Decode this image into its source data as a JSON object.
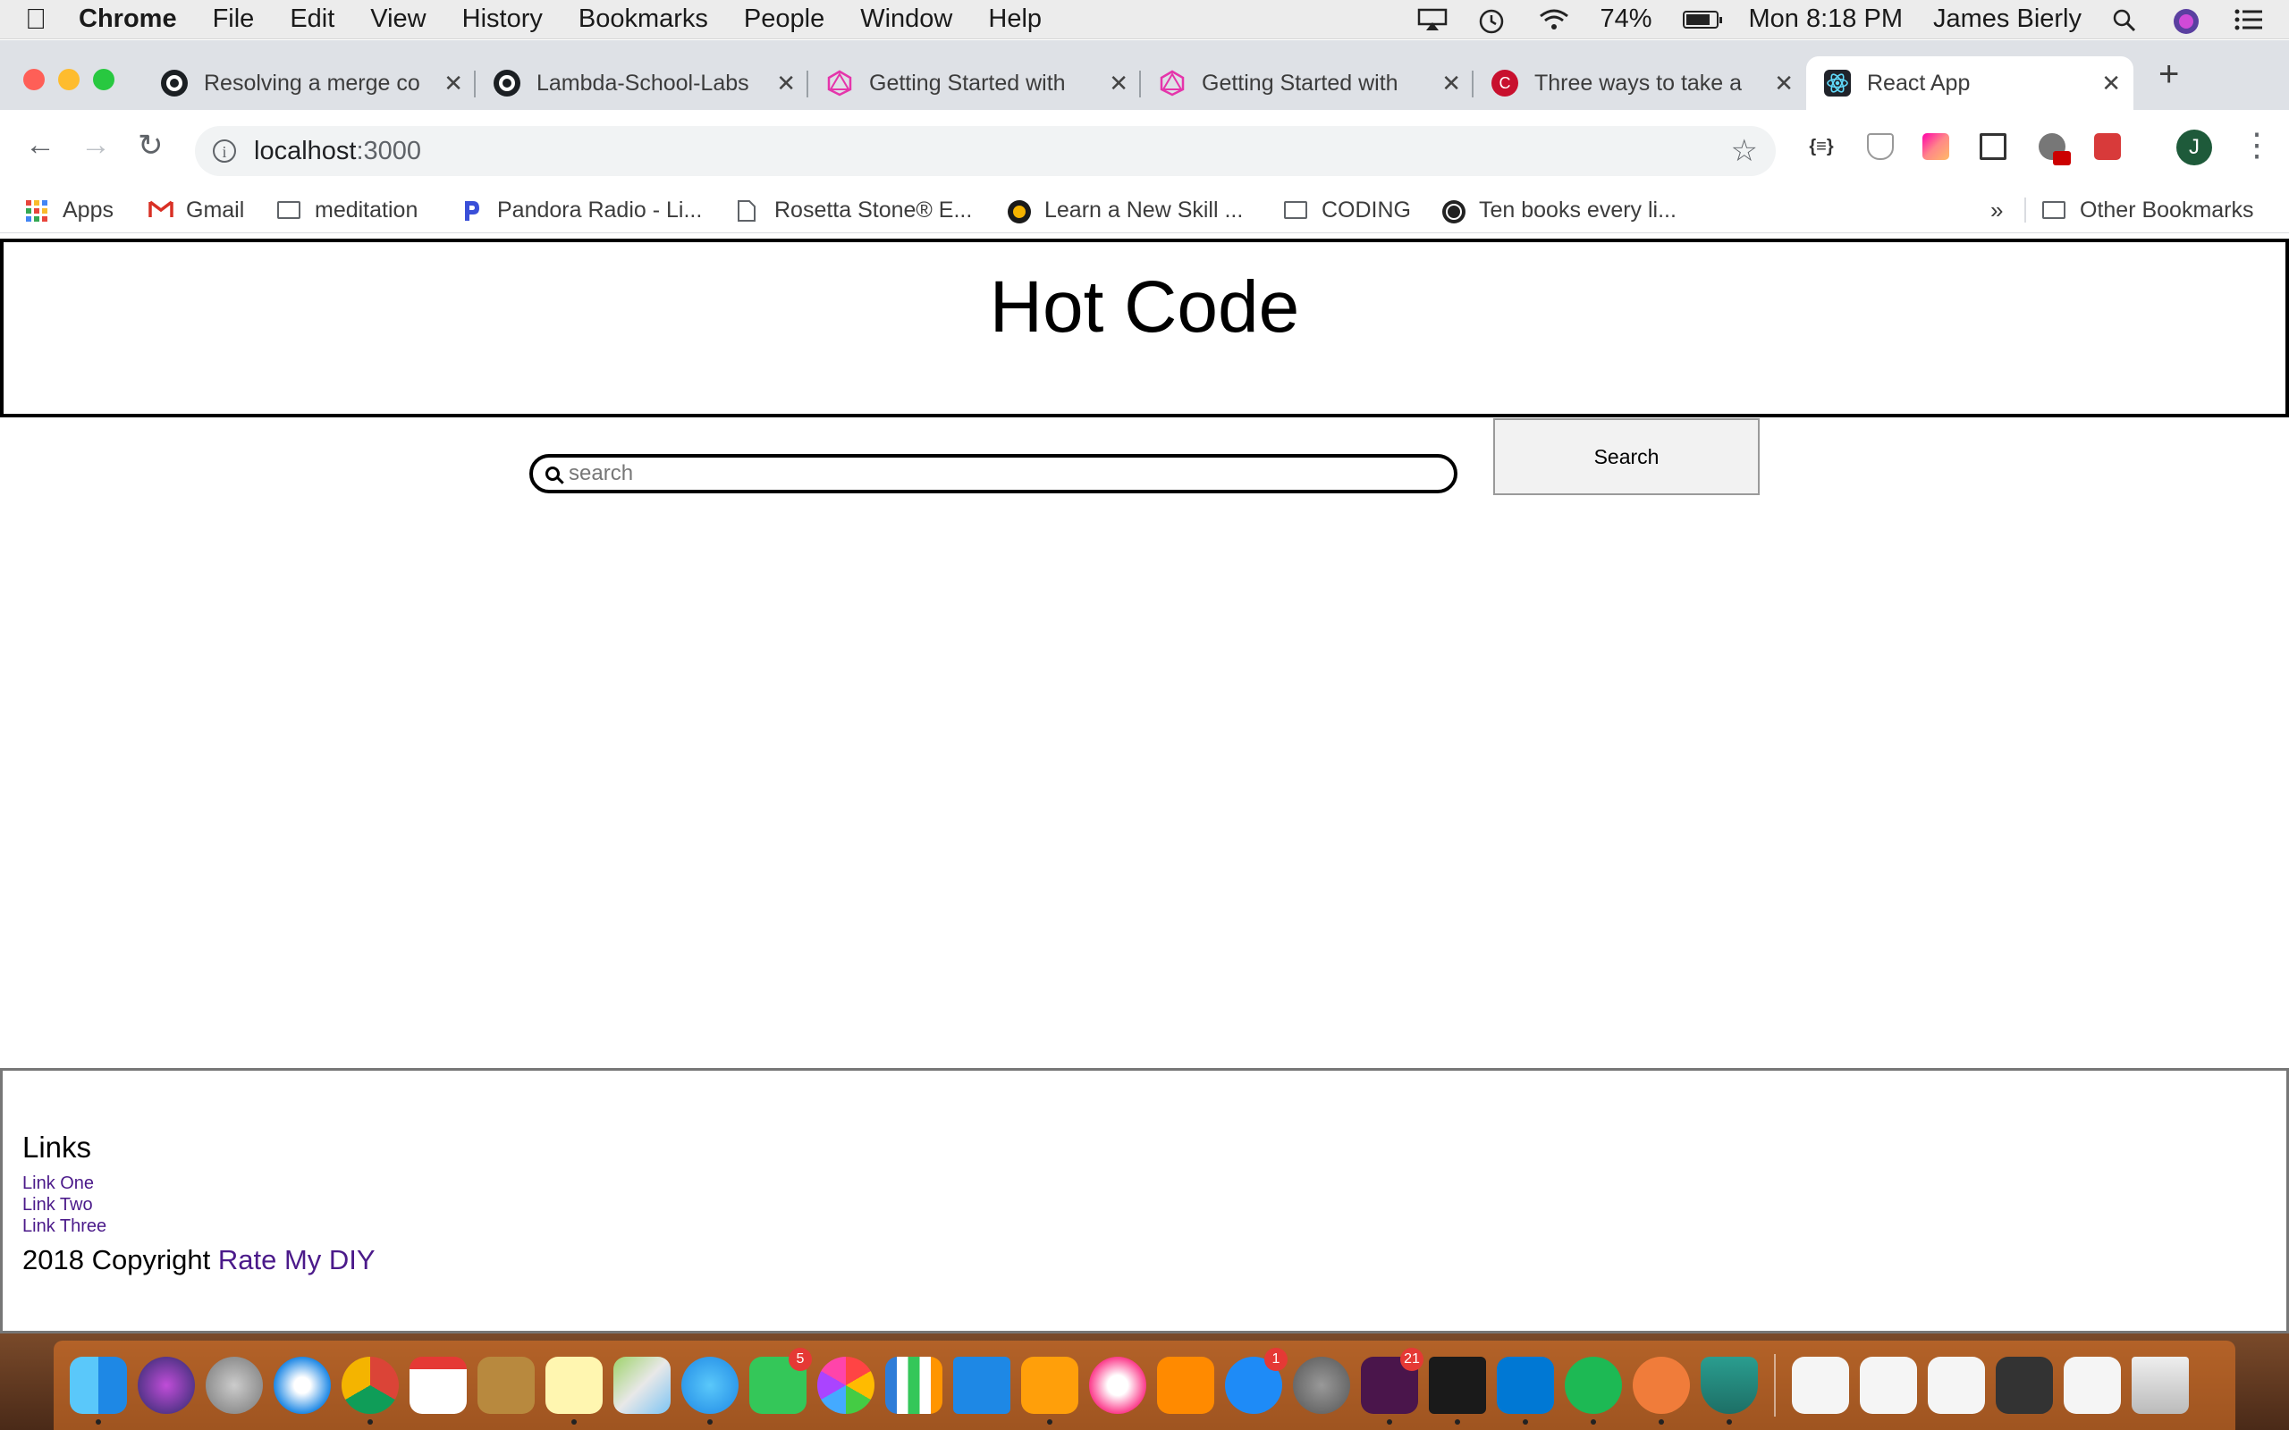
{
  "menubar": {
    "app": "Chrome",
    "items": [
      "File",
      "Edit",
      "View",
      "History",
      "Bookmarks",
      "People",
      "Window",
      "Help"
    ],
    "battery": "74%",
    "clock": "Mon 8:18 PM",
    "user": "James Bierly"
  },
  "tabs": [
    {
      "title": "Resolving a merge co",
      "icon": "github-icon"
    },
    {
      "title": "Lambda-School-Labs",
      "icon": "github-icon"
    },
    {
      "title": "Getting Started with",
      "icon": "graphql-icon"
    },
    {
      "title": "Getting Started with",
      "icon": "graphql-icon"
    },
    {
      "title": "Three ways to take a",
      "icon": "c-logo-icon"
    },
    {
      "title": "React App",
      "icon": "react-icon",
      "active": true
    }
  ],
  "toolbar": {
    "url_host": "localhost",
    "url_port": ":3000"
  },
  "bookmarks": {
    "items": [
      {
        "label": "Apps"
      },
      {
        "label": "Gmail"
      },
      {
        "label": "meditation"
      },
      {
        "label": "Pandora Radio - Li..."
      },
      {
        "label": "Rosetta Stone® E..."
      },
      {
        "label": "Learn a New Skill ..."
      },
      {
        "label": "CODING"
      },
      {
        "label": "Ten books every li..."
      }
    ],
    "overflow": "»",
    "other": "Other Bookmarks"
  },
  "page": {
    "title": "Hot Code",
    "search_placeholder": "search",
    "search_button": "Search",
    "footer": {
      "heading": "Links",
      "links": [
        "Link One",
        "Link Two",
        "Link Three"
      ],
      "copyright_prefix": "2018 Copyright",
      "copyright_link": "Rate My DIY"
    }
  },
  "dock": {
    "badges": {
      "facetime": "5",
      "appstore": "1",
      "slack": "21"
    }
  }
}
